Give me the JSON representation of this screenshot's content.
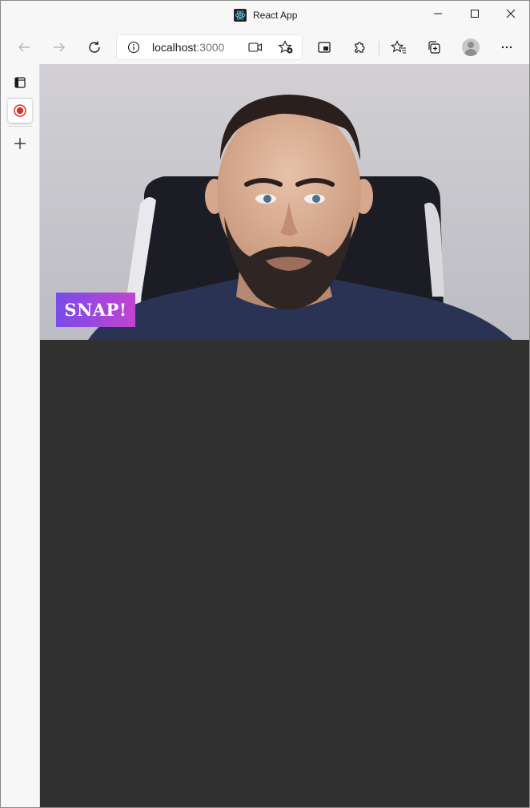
{
  "window": {
    "title": "React App",
    "controls": [
      "minimize-icon",
      "maximize-icon",
      "close-icon"
    ]
  },
  "toolbar": {
    "url_host": "localhost",
    "url_port": ":3000",
    "buttons": [
      "back-icon",
      "forward-icon",
      "refresh-icon",
      "picture-in-picture-icon",
      "extensions-icon",
      "favorites-icon",
      "collections-icon",
      "profile-icon",
      "more-icon"
    ]
  },
  "sidebar": {
    "items": [
      "tab-actions-icon",
      "recording-tab-icon",
      "new-tab-icon"
    ]
  },
  "page": {
    "background": "#303030",
    "snap_label": "SNAP!",
    "snap_gradient": [
      "#7a4bea",
      "#c144d0"
    ]
  }
}
